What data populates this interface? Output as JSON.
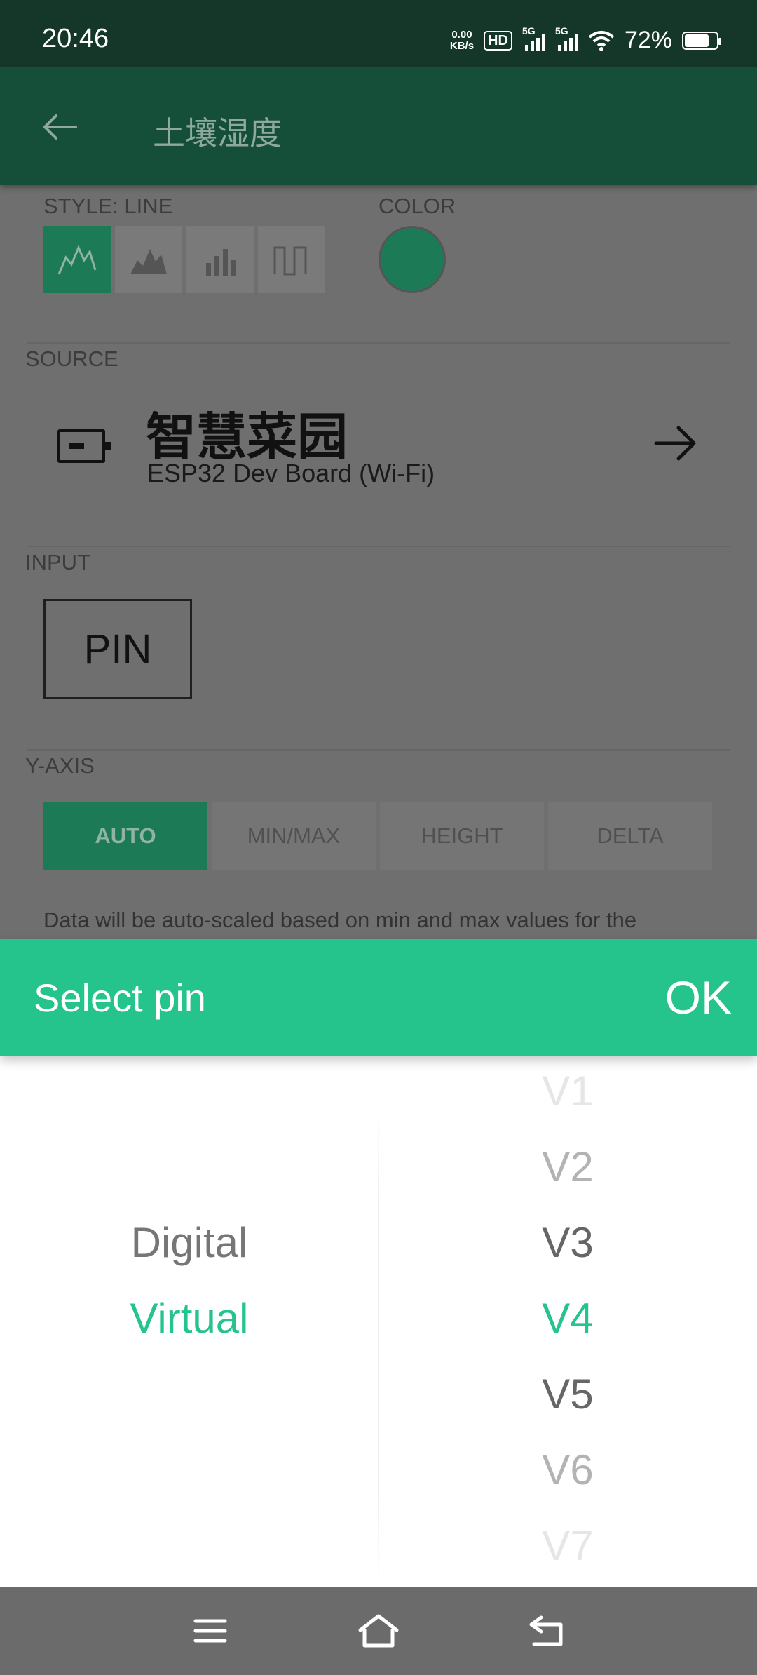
{
  "status_bar": {
    "time": "20:46",
    "net_speed_value": "0.00",
    "net_speed_unit": "KB/s",
    "hd_badge": "HD",
    "sim1_label": "5G",
    "sim2_label": "5G",
    "battery_percent": "72%",
    "icons": [
      "hd-icon",
      "signal-5g-icon",
      "signal-5g-icon",
      "wifi-icon",
      "battery-icon"
    ]
  },
  "app_bar": {
    "title": "土壤湿度",
    "back_icon": "arrow-left-icon"
  },
  "style_section": {
    "label": "STYLE: LINE",
    "options": [
      "line",
      "area",
      "bar",
      "step"
    ],
    "selected": "line",
    "color_label": "COLOR",
    "color": "#1d7a57"
  },
  "source_section": {
    "label": "SOURCE",
    "device_name": "智慧菜园",
    "device_model": "ESP32 Dev Board (Wi-Fi)"
  },
  "input_section": {
    "label": "INPUT",
    "pin_button": "PIN"
  },
  "yaxis_section": {
    "label": "Y-AXIS",
    "options": [
      "AUTO",
      "MIN/MAX",
      "HEIGHT",
      "DELTA"
    ],
    "selected": "AUTO",
    "hint": "Data will be auto-scaled based on min and max values for the"
  },
  "pin_dialog": {
    "title": "Select pin",
    "ok_label": "OK",
    "types": [
      "Digital",
      "Virtual"
    ],
    "selected_type": "Virtual",
    "pins": [
      "V1",
      "V2",
      "V3",
      "V4",
      "V5",
      "V6",
      "V7"
    ],
    "selected_pin": "V4"
  },
  "colors": {
    "accent": "#24c48c",
    "app_bar": "#154e39",
    "status_bar": "#153729"
  },
  "nav_bar": {
    "icons": [
      "menu-icon",
      "home-icon",
      "back-icon"
    ]
  }
}
